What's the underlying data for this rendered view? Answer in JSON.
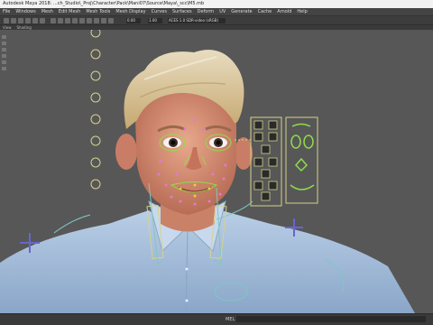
{
  "window": {
    "title": "Autodesk Maya 2018: ...ch_Studio\\_Proj\\Character\\Pack\\Mani07\\Source\\Maya\\_scc\\M5.mb"
  },
  "menubar": {
    "items": [
      "File",
      "Windows",
      "Mesh",
      "Edit Mesh",
      "Mesh Tools",
      "Mesh Display",
      "Curves",
      "Surfaces",
      "Deform",
      "UV",
      "Generate",
      "Cache",
      "Arnold",
      "Help"
    ]
  },
  "toolbar": {
    "field_a": "0.00",
    "field_b": "1.00",
    "colorspace": "ACES 1.0 SDR-video (sRGB)"
  },
  "panel": {
    "menu": [
      "View",
      "Shading",
      "Lighting",
      "Show",
      "Renderer",
      "Panels"
    ]
  },
  "statusbar": {
    "mel_label": "MEL"
  },
  "colors": {
    "rig_green": "#8fdc4a",
    "controller_yellow": "#d6d28a",
    "controller_blue": "#6666cc",
    "control_dot_pink": "#e07ad0",
    "shirt_blue": "#a9c2de"
  },
  "icons": {
    "move_tool": "move-icon",
    "select_tool": "select-icon"
  }
}
